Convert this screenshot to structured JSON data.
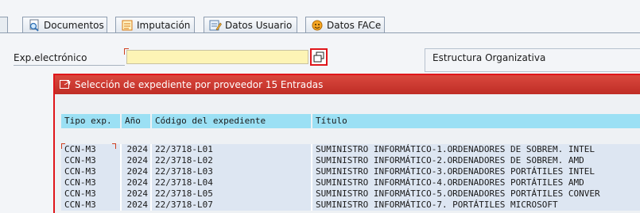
{
  "tabs": [
    {
      "label": "Documentos",
      "icon": "documents-search-icon"
    },
    {
      "label": "Imputación",
      "icon": "imputation-icon"
    },
    {
      "label": "Datos Usuario",
      "icon": "user-data-icon"
    },
    {
      "label": "Datos FACe",
      "icon": "face-data-icon"
    }
  ],
  "form": {
    "field_label": "Exp.electrónico",
    "field_value": "",
    "group_title": "Estructura Organizativa"
  },
  "popup": {
    "title": "Selección de expediente por proveedor  15 Entradas",
    "columns": [
      "Tipo exp.",
      "Año",
      "Código del expediente",
      "Título"
    ],
    "rows": [
      [
        "CCN-M3",
        "2024",
        "22/3718-L01",
        "SUMINISTRO INFORMÁTICO-1.ORDENADORES DE SOBREM. INTEL"
      ],
      [
        "CCN-M3",
        "2024",
        "22/3718-L02",
        "SUMINISTRO INFORMÁTICO-2.ORDENADORES DE SOBREM. AMD"
      ],
      [
        "CCN-M3",
        "2024",
        "22/3718-L03",
        "SUMINISTRO INFORMÁTICO-3.ORDENADORES PORTÁTILES INTEL"
      ],
      [
        "CCN-M3",
        "2024",
        "22/3718-L04",
        "SUMINISTRO INFORMÁTICO-4.ORDENADORES PORTÁTILES AMD"
      ],
      [
        "CCN-M3",
        "2024",
        "22/3718-L05",
        "SUMINISTRO INFORMÁTICO-5.ORDENADORES PORTÁTILES CONVER"
      ],
      [
        "CCN-M3",
        "2024",
        "22/3718-L07",
        "SUMINISTRO INFORMÁTICO-7. PORTÁTILES MICROSOFT"
      ]
    ]
  },
  "colors": {
    "accent_red": "#e0161b",
    "popup_title": "#c8352c",
    "input_required": "#fdf4b5",
    "grid_header": "#9be0f4"
  }
}
